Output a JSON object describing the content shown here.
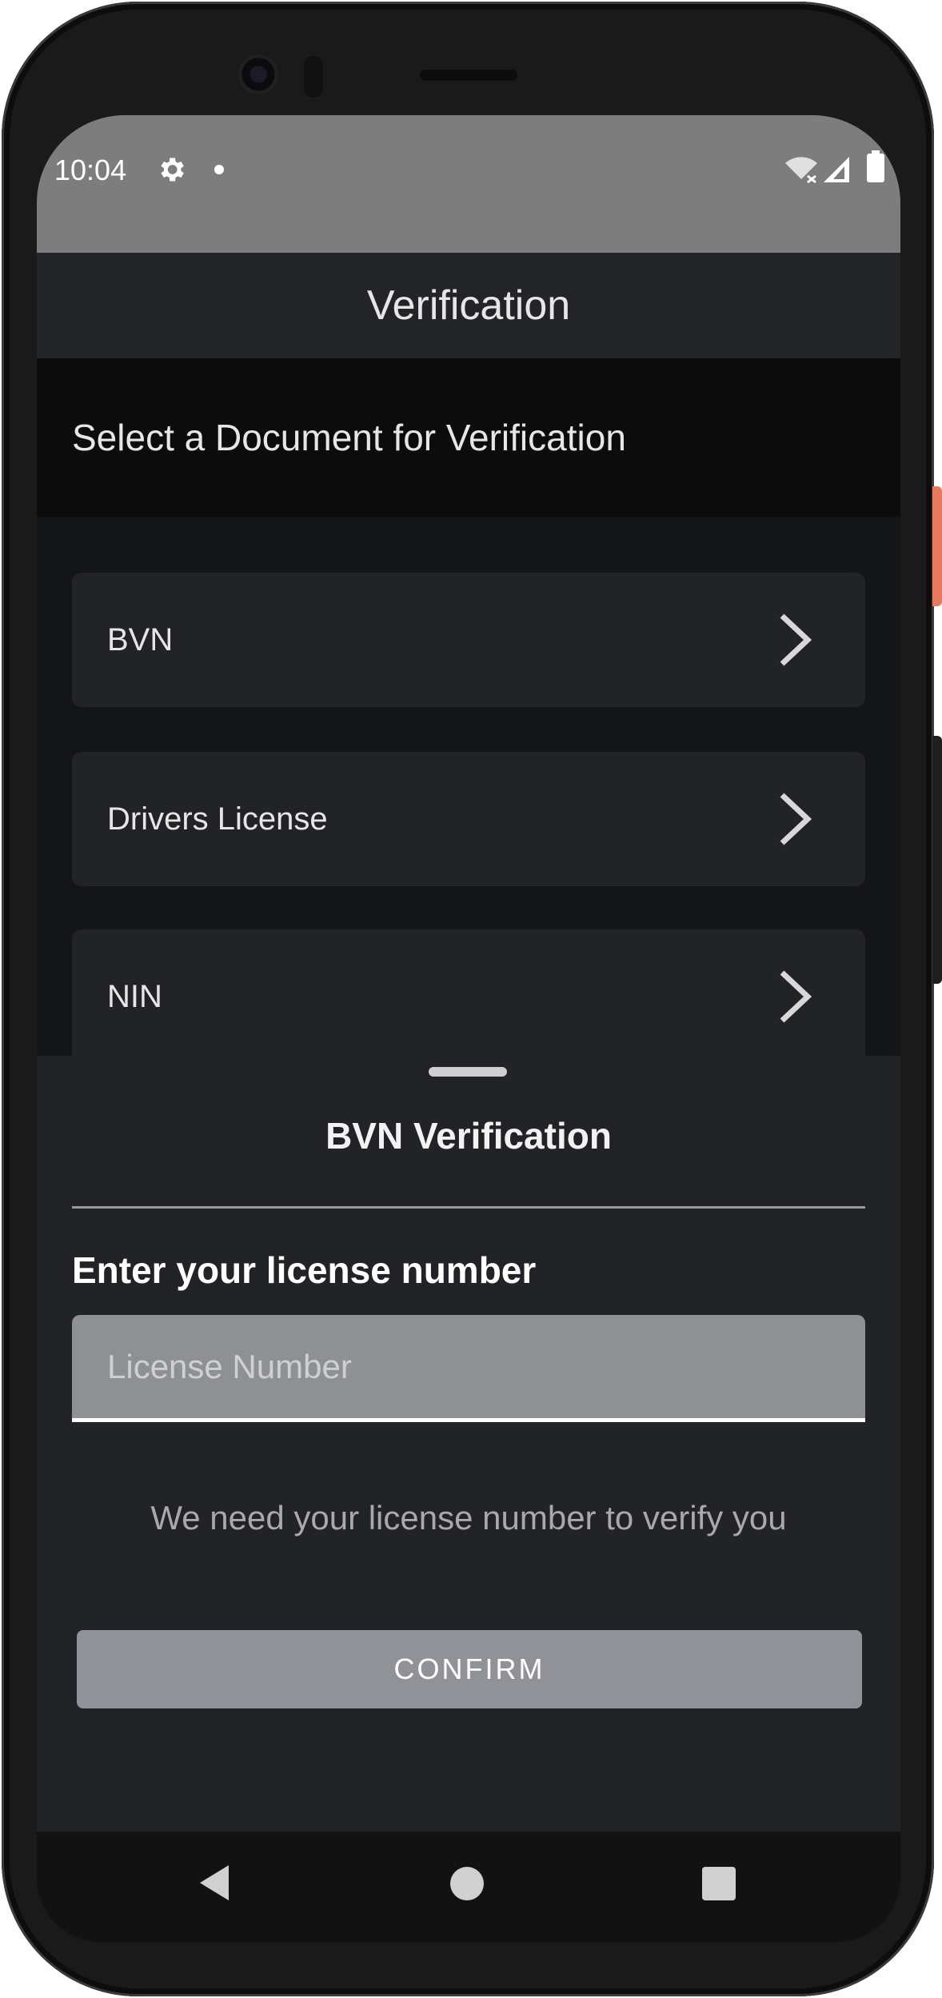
{
  "status_bar": {
    "time": "10:04",
    "icons": [
      "gear-icon",
      "notification-dot-icon",
      "wifi-off-icon",
      "signal-icon",
      "battery-icon"
    ]
  },
  "app_bar": {
    "title": "Verification"
  },
  "section": {
    "title": "Select a Document for Verification"
  },
  "documents": [
    {
      "label": "BVN"
    },
    {
      "label": "Drivers License"
    },
    {
      "label": "NIN"
    }
  ],
  "sheet": {
    "title": "BVN Verification",
    "field_label": "Enter your license number",
    "input_value": "",
    "input_placeholder": "License Number",
    "helper_text": "We need your license number to verify you",
    "confirm_label": "CONFIRM"
  },
  "colors": {
    "status_bar": "#7d7d7d",
    "app_bar": "#232427",
    "background": "#141517",
    "card": "#222326",
    "input": "#8e9094",
    "button": "#909297"
  }
}
